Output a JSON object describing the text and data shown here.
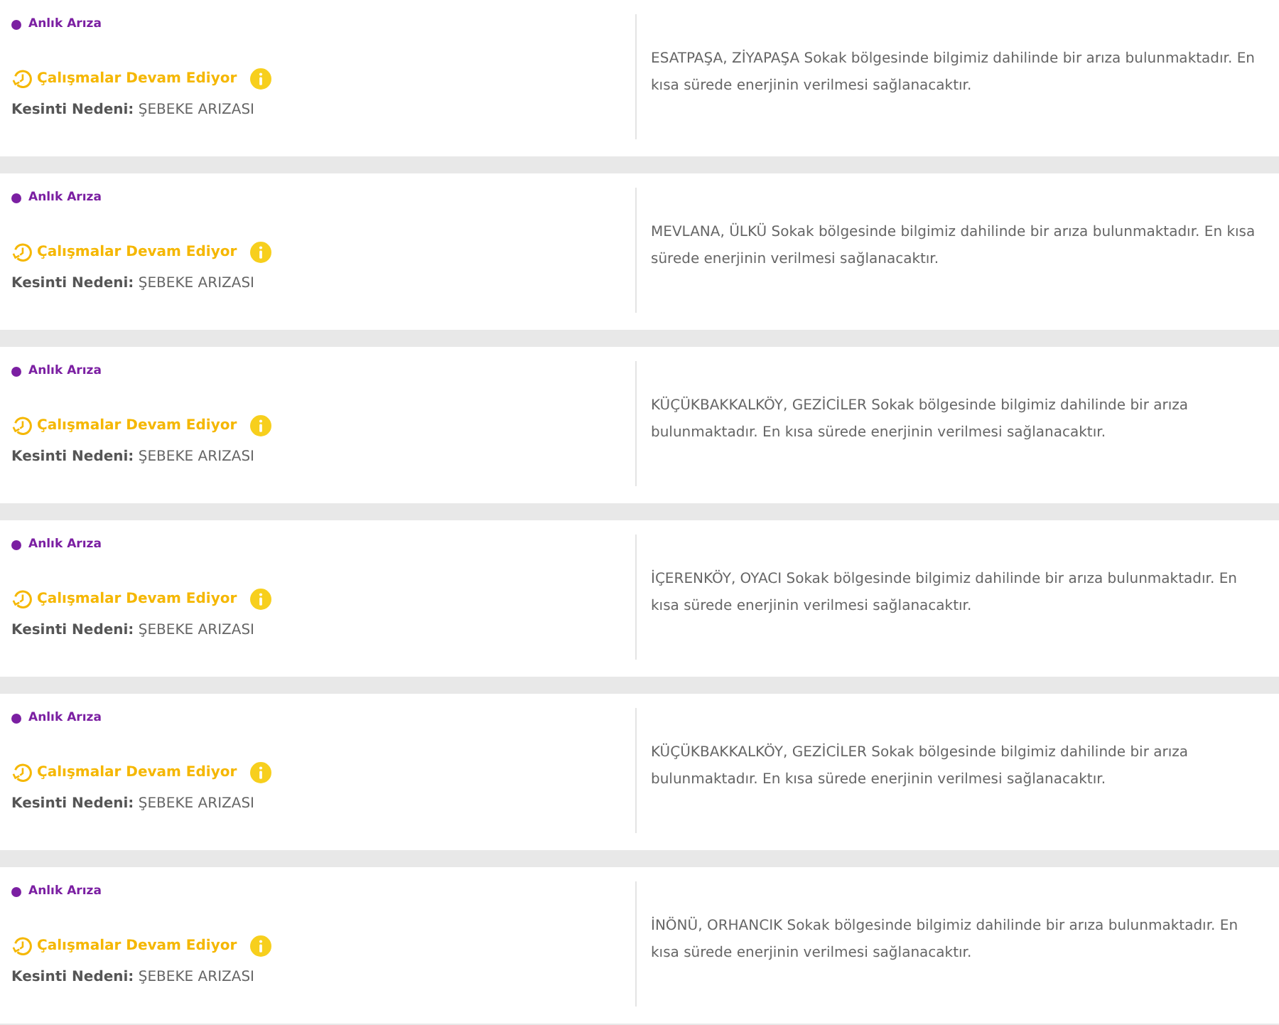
{
  "outages": [
    {
      "type_label": "Anlık Arıza",
      "color": "#7b1fa2",
      "status": "Çalışmalar Devam Ediyor",
      "reason_label": "Kesinti Nedeni:",
      "reason": "ŞEBEKE ARIZASI",
      "description": "ESATPAŞA, ZİYAPAŞA Sokak bölgesinde bilgimiz dahilinde bir arıza bulunmaktadır. En kısa sürede enerjinin verilmesi sağlanacaktır."
    },
    {
      "type_label": "Anlık Arıza",
      "color": "#7b1fa2",
      "status": "Çalışmalar Devam Ediyor",
      "reason_label": "Kesinti Nedeni:",
      "reason": "ŞEBEKE ARIZASI",
      "description": "MEVLANA, ÜLKÜ Sokak bölgesinde bilgimiz dahilinde bir arıza bulunmaktadır. En kısa sürede enerjinin verilmesi sağlanacaktır."
    },
    {
      "type_label": "Anlık Arıza",
      "color": "#7b1fa2",
      "status": "Çalışmalar Devam Ediyor",
      "reason_label": "Kesinti Nedeni:",
      "reason": "ŞEBEKE ARIZASI",
      "description": "KÜÇÜKBAKKALKÖY, GEZİCİLER Sokak bölgesinde bilgimiz dahilinde bir arıza bulunmaktadır. En kısa sürede enerjinin verilmesi sağlanacaktır."
    },
    {
      "type_label": "Anlık Arıza",
      "color": "#7b1fa2",
      "status": "Çalışmalar Devam Ediyor",
      "reason_label": "Kesinti Nedeni:",
      "reason": "ŞEBEKE ARIZASI",
      "description": "İÇERENKÖY, OYACI Sokak bölgesinde bilgimiz dahilinde bir arıza bulunmaktadır. En kısa sürede enerjinin verilmesi sağlanacaktır."
    },
    {
      "type_label": "Anlık Arıza",
      "color": "#7b1fa2",
      "status": "Çalışmalar Devam Ediyor",
      "reason_label": "Kesinti Nedeni:",
      "reason": "ŞEBEKE ARIZASI",
      "description": "KÜÇÜKBAKKALKÖY, GEZİCİLER Sokak bölgesinde bilgimiz dahilinde bir arıza bulunmaktadır. En kısa sürede enerjinin verilmesi sağlanacaktır."
    },
    {
      "type_label": "Anlık Arıza",
      "color": "#7b1fa2",
      "status": "Çalışmalar Devam Ediyor",
      "reason_label": "Kesinti Nedeni:",
      "reason": "ŞEBEKE ARIZASI",
      "description": "İNÖNÜ, ORHANCIK Sokak bölgesinde bilgimiz dahilinde bir arıza bulunmaktadır. En kısa sürede enerjinin verilmesi sağlanacaktır."
    }
  ]
}
